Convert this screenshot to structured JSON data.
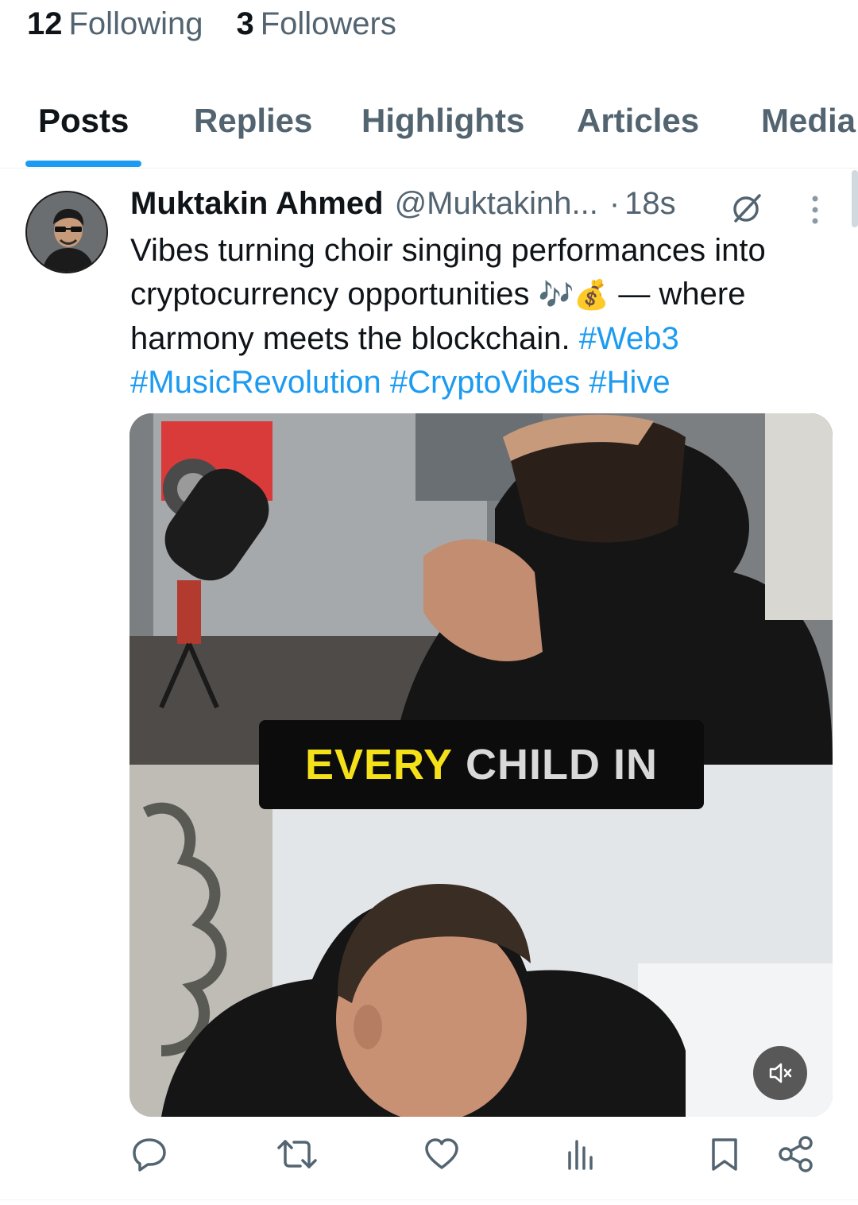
{
  "profile_stats": {
    "following_count": "12",
    "following_label": "Following",
    "followers_count": "3",
    "followers_label": "Followers"
  },
  "tabs": [
    {
      "label": "Posts",
      "active": true
    },
    {
      "label": "Replies",
      "active": false
    },
    {
      "label": "Highlights",
      "active": false
    },
    {
      "label": "Articles",
      "active": false
    },
    {
      "label": "Media",
      "active": false
    }
  ],
  "post": {
    "author_name": "Muktakin Ahmed",
    "author_handle": "@Muktakinh...",
    "separator": "·",
    "time": "18s",
    "text_part1": "Vibes turning choir singing performances into cryptocurrency opportunities",
    "emoji_notes": "🎶",
    "emoji_money": "💰",
    "text_part2": "— where harmony meets the blockchain.",
    "hashtags": [
      "#Web3",
      "#MusicRevolution",
      "#CryptoVibes",
      "#Hive"
    ],
    "media_caption_yellow": "EVERY",
    "media_caption_white": "CHILD IN"
  },
  "icons": {
    "grok": "grok-icon",
    "more": "more-vertical-icon",
    "mute": "volume-muted-icon",
    "reply": "reply-icon",
    "repost": "repost-icon",
    "like": "heart-icon",
    "views": "views-icon",
    "bookmark": "bookmark-icon",
    "share": "share-icon"
  },
  "colors": {
    "accent": "#1d9bf0",
    "text_primary": "#0f1419",
    "text_secondary": "#536471",
    "caption_yellow": "#f5e11a"
  }
}
